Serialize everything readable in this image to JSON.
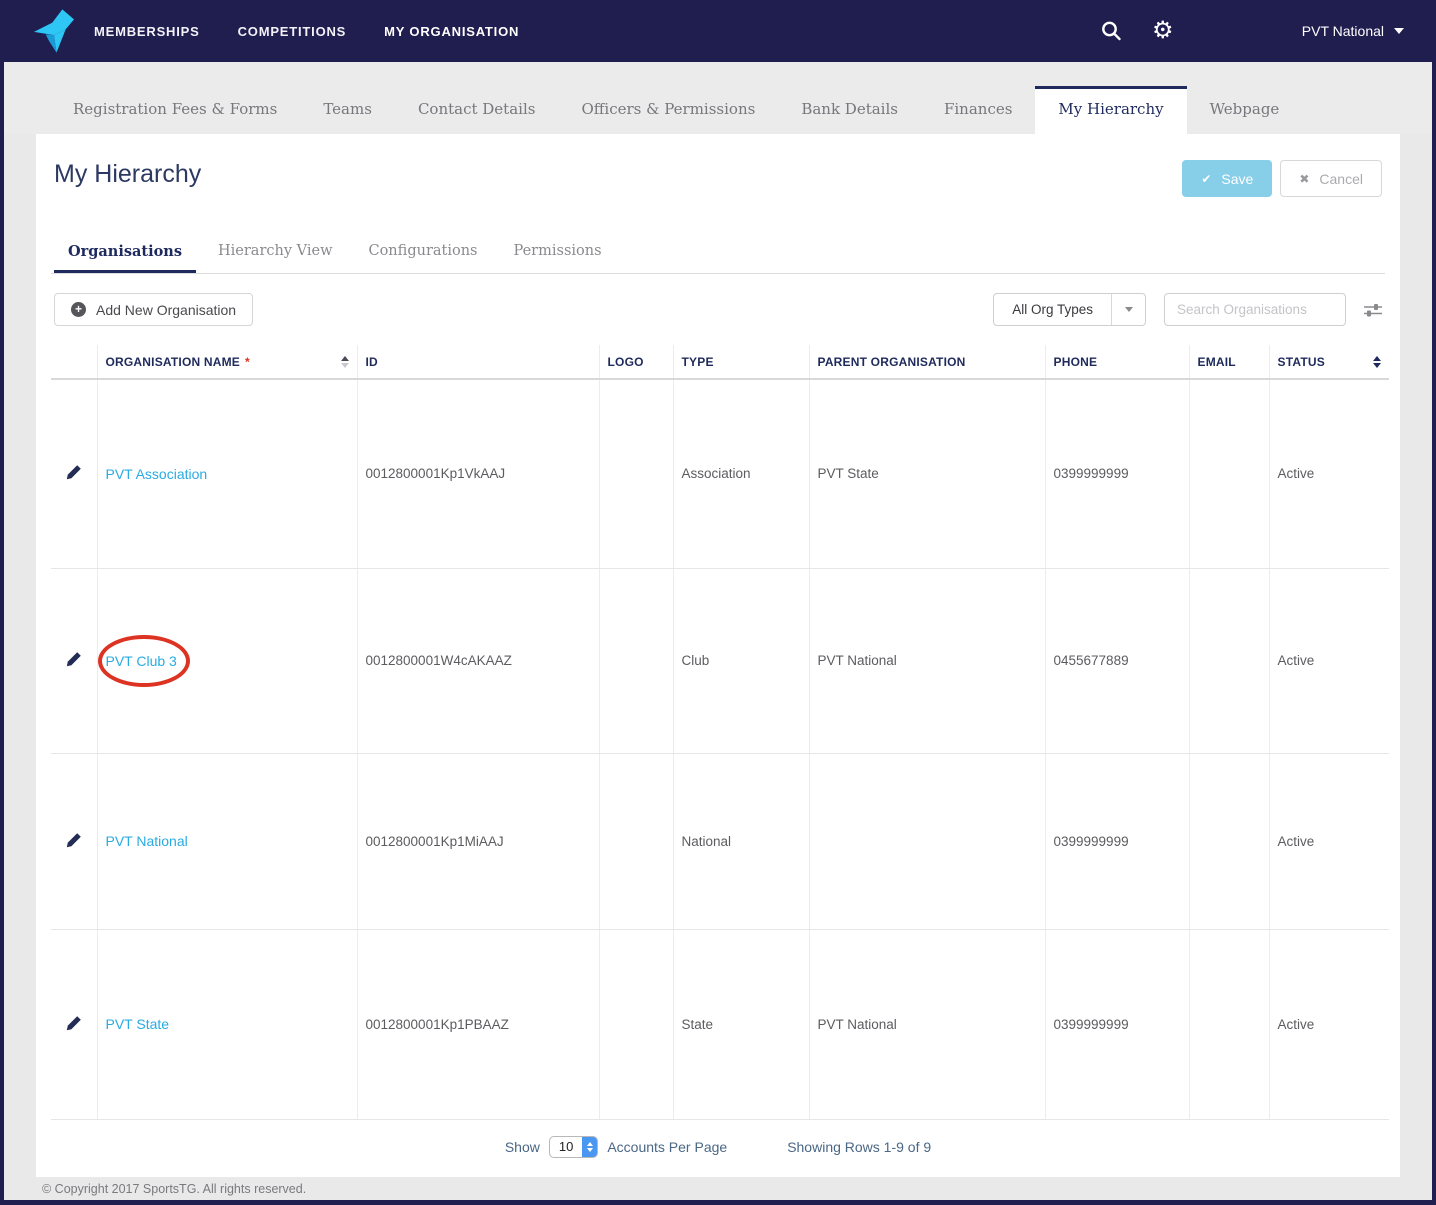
{
  "navbar": {
    "items": [
      {
        "label": "MEMBERSHIPS",
        "active": false
      },
      {
        "label": "COMPETITIONS",
        "active": false
      },
      {
        "label": "MY ORGANISATION",
        "active": true
      }
    ],
    "org_switcher": "PVT National"
  },
  "main_tabs": [
    {
      "label": "Registration Fees & Forms"
    },
    {
      "label": "Teams"
    },
    {
      "label": "Contact Details"
    },
    {
      "label": "Officers & Permissions"
    },
    {
      "label": "Bank Details"
    },
    {
      "label": "Finances"
    },
    {
      "label": "My Hierarchy",
      "active": true
    },
    {
      "label": "Webpage"
    }
  ],
  "page": {
    "title": "My Hierarchy",
    "save_label": "Save",
    "save_icon": "✔",
    "cancel_label": "Cancel",
    "cancel_icon": "✖"
  },
  "sub_tabs": [
    {
      "label": "Organisations",
      "active": true
    },
    {
      "label": "Hierarchy View"
    },
    {
      "label": "Configurations"
    },
    {
      "label": "Permissions"
    }
  ],
  "toolbar": {
    "add_button": "Add New Organisation",
    "add_icon": "+",
    "org_type_filter": "All Org Types",
    "search_placeholder": "Search Organisations"
  },
  "table": {
    "columns": [
      {
        "label": ""
      },
      {
        "label": "ORGANISATION NAME",
        "marker": "*"
      },
      {
        "label": "ID"
      },
      {
        "label": "LOGO"
      },
      {
        "label": "TYPE"
      },
      {
        "label": "PARENT ORGANISATION"
      },
      {
        "label": "PHONE"
      },
      {
        "label": "EMAIL"
      },
      {
        "label": "STATUS"
      }
    ],
    "rows": [
      {
        "name": "PVT Association",
        "id": "0012800001Kp1VkAAJ",
        "logo": "",
        "type": "Association",
        "parent": "PVT State",
        "phone": "0399999999",
        "email": "",
        "status": "Active"
      },
      {
        "name": "PVT Club 3",
        "id": "0012800001W4cAKAAZ",
        "logo": "",
        "type": "Club",
        "parent": "PVT National",
        "phone": "0455677889",
        "email": "",
        "status": "Active"
      },
      {
        "name": "PVT National",
        "id": "0012800001Kp1MiAAJ",
        "logo": "",
        "type": "National",
        "parent": "",
        "phone": "0399999999",
        "email": "",
        "status": "Active"
      },
      {
        "name": "PVT State",
        "id": "0012800001Kp1PBAAZ",
        "logo": "",
        "type": "State",
        "parent": "PVT National",
        "phone": "0399999999",
        "email": "",
        "status": "Active"
      }
    ]
  },
  "pagination": {
    "show_label": "Show",
    "per_page": "10",
    "per_page_label": "Accounts Per Page",
    "summary": "Showing Rows 1-9 of 9"
  },
  "footer": {
    "copyright": "© Copyright 2017 SportsTG. All rights reserved."
  },
  "colors": {
    "navbar_navy": "#201d4f",
    "heading_navy": "#1e2a5e",
    "link_blue": "#29abe2",
    "save_blue": "#87cee9",
    "brand_cyan": "#2ec6f5",
    "required_red": "#e0301e",
    "annotation_red": "#dd3322"
  }
}
